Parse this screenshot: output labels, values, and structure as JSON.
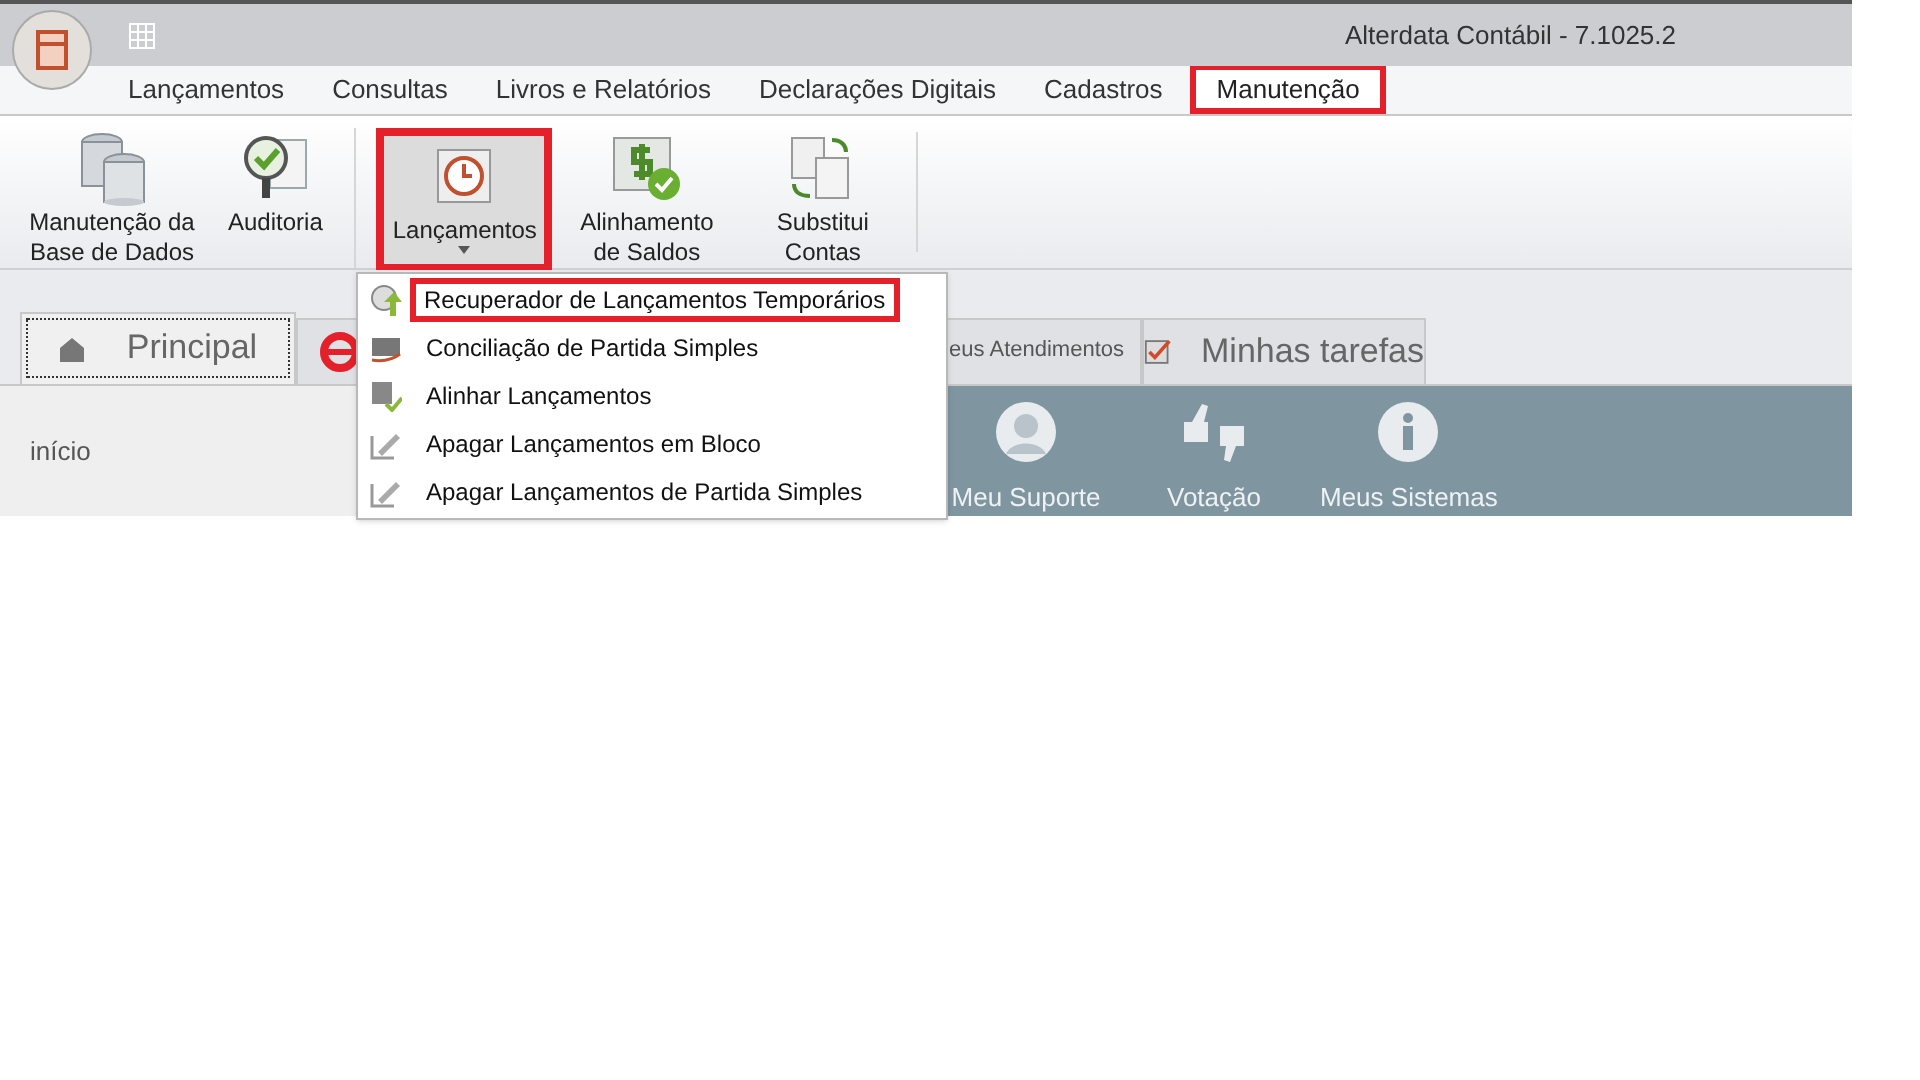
{
  "window": {
    "title": "Alterdata Contábil - 7.1025.2"
  },
  "menu_tabs": [
    {
      "label": "Lançamentos",
      "selected": false
    },
    {
      "label": "Consultas",
      "selected": false
    },
    {
      "label": "Livros e Relatórios",
      "selected": false
    },
    {
      "label": "Declarações Digitais",
      "selected": false
    },
    {
      "label": "Cadastros",
      "selected": false
    },
    {
      "label": "Manutenção",
      "selected": true
    }
  ],
  "ribbon": [
    {
      "kind": "database",
      "label": "Manutenção da Base de Dados",
      "highlighted": false,
      "dropdown": false
    },
    {
      "kind": "audit",
      "label": "Auditoria",
      "highlighted": false,
      "dropdown": false
    },
    {
      "kind": "clock",
      "label": "Lançamentos",
      "highlighted": true,
      "dropdown": true
    },
    {
      "kind": "money",
      "label": "Alinhamento de Saldos",
      "highlighted": false,
      "dropdown": false
    },
    {
      "kind": "swap",
      "label": "Substitui Contas",
      "highlighted": false,
      "dropdown": false
    }
  ],
  "dropdown_menu": [
    {
      "kind": "recover",
      "label": "Recuperador de Lançamentos Temporários",
      "highlighted": true
    },
    {
      "kind": "reconcile",
      "label": "Conciliação de Partida Simples",
      "highlighted": false
    },
    {
      "kind": "align",
      "label": "Alinhar Lançamentos",
      "highlighted": false
    },
    {
      "kind": "erase",
      "label": "Apagar Lançamentos em Bloco",
      "highlighted": false
    },
    {
      "kind": "erase",
      "label": "Apagar Lançamentos de Partida Simples",
      "highlighted": false
    }
  ],
  "page_tabs": [
    {
      "kind": "home",
      "label": "Principal",
      "selected": true
    },
    {
      "kind": "e",
      "selected": false
    },
    {
      "kind": "plain",
      "label": "eus Atendimentos",
      "selected": false
    },
    {
      "kind": "tasks",
      "label": "Minhas tarefas",
      "selected": false
    }
  ],
  "left_panel": {
    "label": "início"
  },
  "shortcuts": [
    {
      "kind": "user",
      "label": "Meu Suporte"
    },
    {
      "kind": "vote",
      "label": "Votação"
    },
    {
      "kind": "info",
      "label": "Meus Sistemas"
    }
  ]
}
